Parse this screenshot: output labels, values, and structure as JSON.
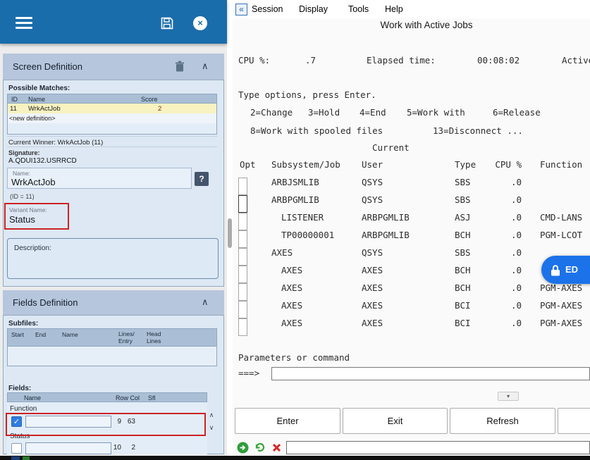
{
  "colors": {
    "header_blue": "#1a6dab",
    "section_header": "#b6c6dc",
    "panel_bg": "#dde8f4",
    "highlight_yellow": "#f7f2c0",
    "annotation_red": "#cc2323",
    "edit_pill_blue": "#1c72e8"
  },
  "icons": {
    "close": "×",
    "chevron_up": "∧",
    "scroll_up": "∧",
    "scroll_down": "∨",
    "collapse_panel": "«",
    "toggle_down": "▾",
    "check": "✓",
    "help": "?"
  },
  "left_panel": {
    "screen_definition": {
      "title": "Screen Definition",
      "possible_matches_label": "Possible Matches:",
      "matches": {
        "header_id": "ID",
        "header_name": "Name",
        "header_score": "Score",
        "row_id": "11",
        "row_name": "WrkActJob",
        "row_score": "2",
        "new_definition": "<new definition>"
      },
      "current_winner": "Current Winner: WrkActJob (11)",
      "signature_label": "Signature:",
      "signature_value": "A.QDUI132.USRRCD",
      "name_label": "Name:",
      "name_value": "WrkActJob",
      "id_note": "(ID = 11)",
      "variant_label": "Variant Name:",
      "variant_value": "Status",
      "description_label": "Description:"
    },
    "fields_definition": {
      "title": "Fields Definition",
      "subfiles_label": "Subfiles:",
      "subfiles_headers": {
        "start": "Start",
        "end": "End",
        "name": "Name",
        "lines_entry": "Lines/\nEntry",
        "head_lines": "Head\nLines"
      },
      "fields_label": "Fields:",
      "fields_headers": {
        "name": "Name",
        "rowcol": "Row Col",
        "sfl": "Sfl"
      },
      "fields": [
        {
          "label": "Function",
          "row": "9",
          "col": "63"
        },
        {
          "label": "Status",
          "row": "10",
          "col": "2"
        }
      ]
    }
  },
  "terminal": {
    "menu": [
      "Session",
      "Display",
      "Tools",
      "Help"
    ],
    "title": "Work with Active Jobs",
    "stats": {
      "cpu_label": "CPU %:",
      "cpu_value": ".7",
      "elapsed_label": "Elapsed time:",
      "elapsed_value": "00:08:02",
      "active_label": "Active"
    },
    "type_options": "Type options, press Enter.",
    "options_row1": [
      "2=Change",
      "3=Hold",
      "4=End",
      "5=Work with",
      "6=Release"
    ],
    "options_row2": [
      "8=Work with spooled files",
      "13=Disconnect ..."
    ],
    "current_label": "Current",
    "columns": {
      "opt": "Opt",
      "job": "Subsystem/Job",
      "user": "User",
      "type": "Type",
      "cpu": "CPU %",
      "func": "Function"
    },
    "jobs": [
      {
        "job": "ARBJSMLIB",
        "user": "QSYS",
        "type": "SBS",
        "cpu": ".0",
        "func": ""
      },
      {
        "job": "ARBPGMLIB",
        "user": "QSYS",
        "type": "SBS",
        "cpu": ".0",
        "func": ""
      },
      {
        "job": "LISTENER",
        "user": "ARBPGMLIB",
        "type": "ASJ",
        "cpu": ".0",
        "func": "CMD-LANS"
      },
      {
        "job": "TP00000001",
        "user": "ARBPGMLIB",
        "type": "BCH",
        "cpu": ".0",
        "func": "PGM-LCOT"
      },
      {
        "job": "AXES",
        "user": "QSYS",
        "type": "SBS",
        "cpu": ".0",
        "func": ""
      },
      {
        "job": "AXES",
        "user": "AXES",
        "type": "BCH",
        "cpu": ".0",
        "func": ""
      },
      {
        "job": "AXES",
        "user": "AXES",
        "type": "BCH",
        "cpu": ".0",
        "func": "PGM-AXES"
      },
      {
        "job": "AXES",
        "user": "AXES",
        "type": "BCI",
        "cpu": ".0",
        "func": "PGM-AXES"
      },
      {
        "job": "AXES",
        "user": "AXES",
        "type": "BCI",
        "cpu": ".0",
        "func": "PGM-AXES"
      }
    ],
    "params_label": "Parameters or command",
    "prompt": "===>",
    "buttons": [
      "Enter",
      "Exit",
      "Refresh"
    ],
    "edit_badge": "ED"
  }
}
